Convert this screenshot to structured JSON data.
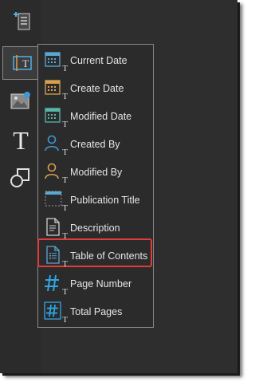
{
  "menu": {
    "items": [
      {
        "label": "Current Date",
        "icon": "calendar-icon"
      },
      {
        "label": "Create Date",
        "icon": "calendar-icon"
      },
      {
        "label": "Modified Date",
        "icon": "calendar-icon"
      },
      {
        "label": "Created By",
        "icon": "person-icon"
      },
      {
        "label": "Modified By",
        "icon": "person-icon"
      },
      {
        "label": "Publication Title",
        "icon": "title-frame-icon"
      },
      {
        "label": "Description",
        "icon": "document-icon"
      },
      {
        "label": "Table of Contents",
        "icon": "list-document-icon"
      },
      {
        "label": "Page Number",
        "icon": "hash-icon"
      },
      {
        "label": "Total Pages",
        "icon": "boxed-hash-icon"
      }
    ],
    "highlighted_index": 7
  },
  "toolbar": {
    "text_tool_glyph": "T",
    "sub_glyph": "T"
  },
  "colors": {
    "highlight": "#e03c3c",
    "calendar_current": "#5aa7d6",
    "calendar_create": "#d9a050",
    "calendar_modified": "#58b6a8",
    "person_blue": "#3c9ad8",
    "person_orange": "#d9a050",
    "hash_blue": "#2fa6e6"
  }
}
